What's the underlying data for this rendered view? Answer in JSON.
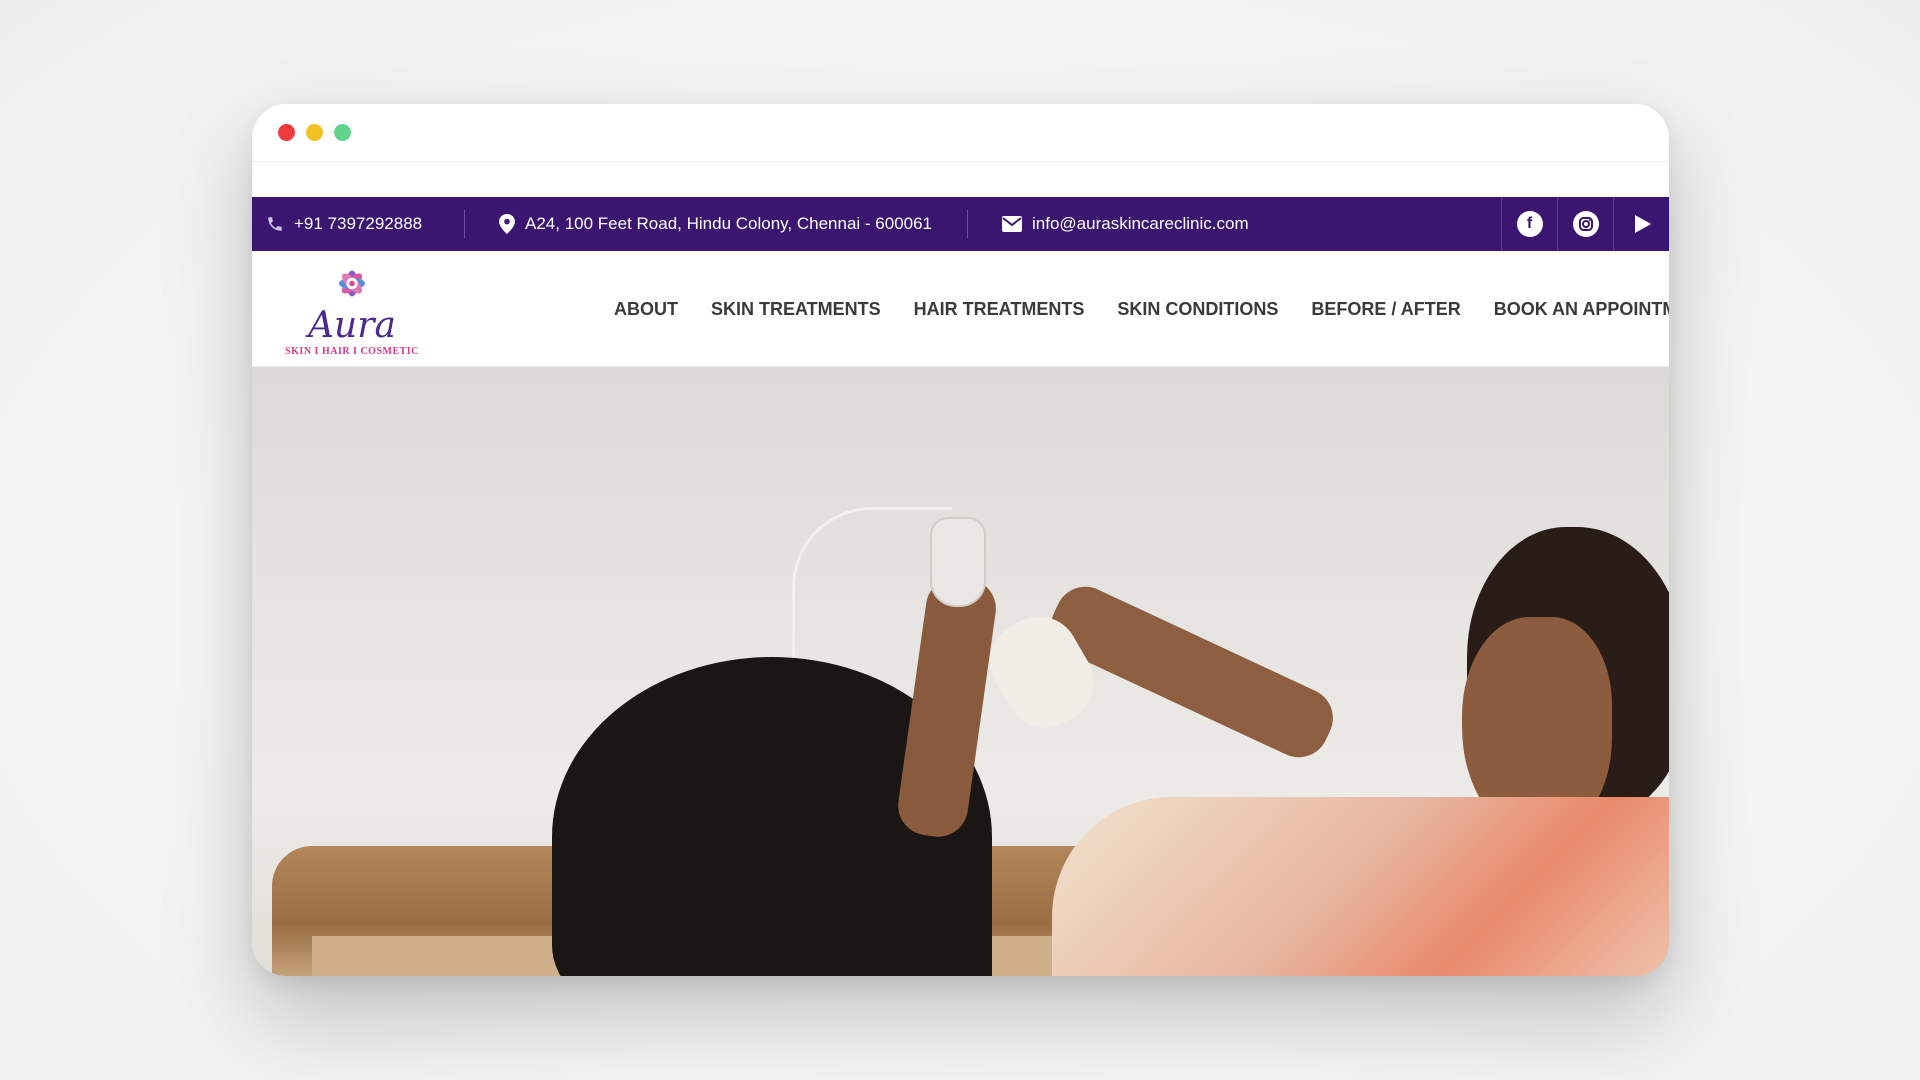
{
  "topbar": {
    "phone": "+91 7397292888",
    "address": "A24, 100 Feet Road, Hindu Colony, Chennai - 600061",
    "email": "info@auraskincareclinic.com",
    "social": [
      "facebook-icon",
      "instagram-icon",
      "youtube-play-icon"
    ]
  },
  "logo": {
    "name": "Aura",
    "tagline": "SKIN I HAIR I COSMETIC"
  },
  "nav": {
    "items": [
      "ABOUT",
      "SKIN TREATMENTS",
      "HAIR TREATMENTS",
      "SKIN CONDITIONS",
      "BEFORE / AFTER",
      "BOOK AN APPOINTMENT"
    ]
  },
  "colors": {
    "topbar_bg": "#3a1670",
    "logo_purple": "#4a2a8a",
    "logo_pink": "#d43a8a",
    "menu_text": "#3a3a3a"
  }
}
